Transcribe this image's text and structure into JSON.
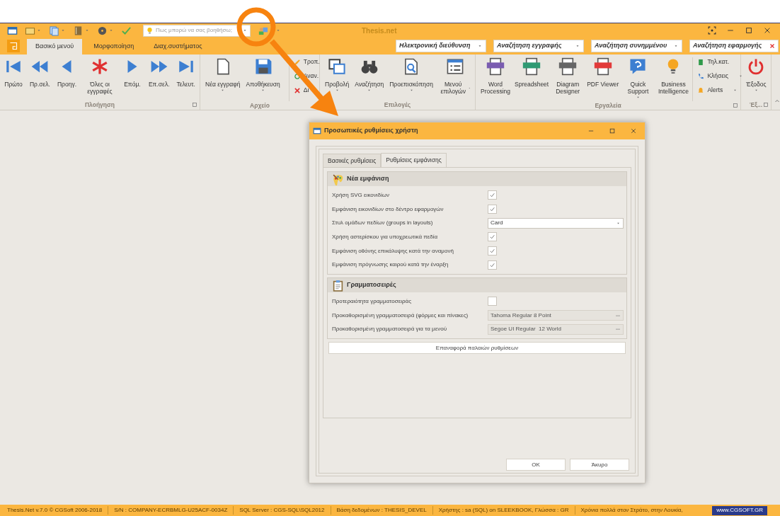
{
  "window": {
    "title": "Thesis.net",
    "help_search": {
      "placeholder": "Πως μπορώ να σας βοηθήσω;"
    }
  },
  "tabs": [
    {
      "label": "Βασικό μενού",
      "selected": true
    },
    {
      "label": "Μορφοποίηση",
      "selected": false
    },
    {
      "label": "Διαχ.συστήματος",
      "selected": false
    }
  ],
  "search_boxes": [
    {
      "text": "Ηλεκτρονική διεύθυνση",
      "kind": "dropdown"
    },
    {
      "text": "Αναζήτηση εγγραφής",
      "kind": "dropdown"
    },
    {
      "text": "Αναζήτηση συνημμένου",
      "kind": "dropdown"
    },
    {
      "text": "Αναζήτηση εφαρμογής",
      "kind": "clear"
    }
  ],
  "ribbon_groups": [
    {
      "title": "Πλοήγηση",
      "launcher": true,
      "buttons": [
        {
          "label": "Πρώτο",
          "kind": "large",
          "dropdown": false
        },
        {
          "label": "Πρ.σελ.",
          "kind": "large",
          "dropdown": false
        },
        {
          "label": "Προηγ.",
          "kind": "large",
          "dropdown": false
        },
        {
          "label": "Όλες οι εγγραφές",
          "kind": "large",
          "dropdown": false
        },
        {
          "label": "Επόμ.",
          "kind": "large",
          "dropdown": false
        },
        {
          "label": "Επ.σελ.",
          "kind": "large",
          "dropdown": false
        },
        {
          "label": "Τελευτ.",
          "kind": "large",
          "dropdown": false
        }
      ]
    },
    {
      "title": "Αρχείο",
      "launcher": false,
      "buttons": [
        {
          "label": "Νέα εγγραφή",
          "kind": "large",
          "dropdown": true
        },
        {
          "label": "Αποθήκευση",
          "kind": "large",
          "dropdown": true
        },
        {
          "label": "Τροπ.",
          "kind": "small",
          "dropdown": false
        },
        {
          "label": "Αναν.",
          "kind": "small",
          "dropdown": false
        },
        {
          "label": "Δι",
          "kind": "small",
          "dropdown": false
        }
      ]
    },
    {
      "title": "Επιλογές",
      "launcher": false,
      "buttons": [
        {
          "label": "Προβολή",
          "kind": "large",
          "dropdown": true
        },
        {
          "label": "Αναζήτηση",
          "kind": "large",
          "dropdown": true
        },
        {
          "label": "Προεπισκόπηση",
          "kind": "large",
          "dropdown": true
        },
        {
          "label": "Μενού επιλογών",
          "kind": "large",
          "dropdown": true
        }
      ]
    },
    {
      "title": "Εργαλεία",
      "launcher": true,
      "buttons": [
        {
          "label": "Word Processing",
          "kind": "large",
          "dropdown": false
        },
        {
          "label": "Spreadsheet",
          "kind": "large",
          "dropdown": false
        },
        {
          "label": "Diagram Designer",
          "kind": "large",
          "dropdown": false
        },
        {
          "label": "PDF Viewer",
          "kind": "large",
          "dropdown": false
        },
        {
          "label": "Quick Support",
          "kind": "large",
          "dropdown": true
        },
        {
          "label": "Business Intelligence",
          "kind": "large",
          "dropdown": false
        },
        {
          "label": "Τηλ.κατ.",
          "kind": "small",
          "dropdown": false
        },
        {
          "label": "Κλήσεις",
          "kind": "small",
          "dropdown": true
        },
        {
          "label": "Alerts",
          "kind": "small",
          "dropdown": true
        }
      ]
    },
    {
      "title": "Έξ...",
      "launcher": true,
      "buttons": [
        {
          "label": "Έξοδος",
          "kind": "large",
          "dropdown": true
        }
      ]
    }
  ],
  "dialog": {
    "title": "Προσωπικές ρυθμίσεις χρήστη",
    "tabs": [
      {
        "label": "Βασικές ρυθμίσεις",
        "selected": false
      },
      {
        "label": "Ρυθμίσεις εμφάνισης",
        "selected": true
      }
    ],
    "sections": [
      {
        "title": "Νέα εμφάνιση",
        "rows": [
          {
            "label": "Χρήση SVG εικονιδίων",
            "kind": "checkbox",
            "checked": true
          },
          {
            "label": "Εμφάνιση εικονιδίων στο δέντρο εφαρμογών",
            "kind": "checkbox",
            "checked": true
          },
          {
            "label": "Στυλ ομάδων πεδίων (groups in layouts)",
            "kind": "combo",
            "value": "Card"
          },
          {
            "label": "Χρήση αστερίσκου για υποχρεωτικά πεδία",
            "kind": "checkbox",
            "checked": true
          },
          {
            "label": "Εμφάνιση οθόνης επικάλυψης κατά την αναμονή",
            "kind": "checkbox",
            "checked": true
          },
          {
            "label": "Εμφάνιση πρόγνωσης καιρού κατά την έναρξη",
            "kind": "checkbox",
            "checked": true
          }
        ]
      },
      {
        "title": "Γραμματοσειρές",
        "rows": [
          {
            "label": "Προτεραιότητα γραμματοσειράς",
            "kind": "checkbox",
            "checked": false
          },
          {
            "label": "Προκαθορισμένη γραμματοσειρά (φόρμες και πίνακες)",
            "kind": "picker",
            "value": "Tahoma Regular 8 Point"
          },
          {
            "label": "Προκαθορισμένη γραμματοσειρά για τα μενού",
            "kind": "picker",
            "value": "Segoe UI Regular  12 World"
          }
        ]
      }
    ],
    "reset_button": "Επαναφορά παλαιών ρυθμίσεων",
    "buttons": [
      "OK",
      "Άκυρο"
    ]
  },
  "status_bar": {
    "items": [
      "Thesis.Net v.7.0 © CGSoft 2006-2018",
      "S/N : COMPANY-ECRBMLG-U25ACF-0034Z",
      "SQL Server : CGS-SQL\\SQL2012",
      "Βάση δεδομένων : THESIS_DEVEL",
      "Χρήστης : sa (SQL) on SLEEKBOOK, Γλώσσα : GR",
      "Χρόνια πολλά στον Στράτο, στην Λουκία,"
    ],
    "link": "www.CGSOFT.GR"
  }
}
